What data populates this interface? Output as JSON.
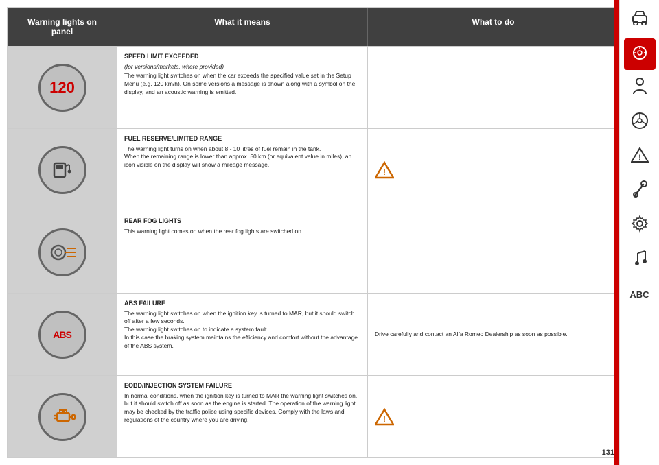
{
  "header": {
    "col1": "Warning lights on\npanel",
    "col2": "What it means",
    "col3": "What to do"
  },
  "rows": [
    {
      "icon_type": "speed",
      "icon_label": "120",
      "title": "SPEED LIMIT EXCEEDED",
      "subtitle": "(for versions/markets, where provided)",
      "meaning": "The warning light switches on when the car exceeds the specified value set in the Setup Menu (e.g. 120 km/h). On some versions a message is shown along with a symbol on the display, and an acoustic warning is emitted.",
      "action": ""
    },
    {
      "icon_type": "fuel",
      "icon_label": "⛽",
      "title": "FUEL RESERVE/LIMITED RANGE",
      "subtitle": "",
      "meaning": "The warning light turns on when about 8 - 10 litres of fuel remain in the tank.\nWhen the remaining range is lower than approx. 50 km (or equivalent value in miles), an icon visible on the display will show a mileage message.",
      "action": "warning_triangle"
    },
    {
      "icon_type": "fog",
      "icon_label": "fog",
      "title": "REAR FOG LIGHTS",
      "subtitle": "",
      "meaning": "This warning light comes on when the rear fog lights are switched on.",
      "action": ""
    },
    {
      "icon_type": "abs",
      "icon_label": "ABS",
      "title": "ABS FAILURE",
      "subtitle": "",
      "meaning": "The warning light switches on when the ignition key is turned to MAR, but it should switch off after a few seconds.\nThe warning light switches on to indicate a system fault.\nIn this case the braking system maintains the efficiency and comfort without the advantage of the ABS system.",
      "action": "Drive carefully and contact an Alfa Romeo Dealership as soon as possible."
    },
    {
      "icon_type": "engine",
      "icon_label": "🔧",
      "title": "EOBD/INJECTION SYSTEM FAILURE",
      "subtitle": "",
      "meaning": "In normal conditions, when the ignition key is turned to MAR the warning light switches on, but it should switch off as soon as the engine is started. The operation of the warning light may be checked by the traffic police using specific devices. Comply with the laws and regulations of the country where you are driving.",
      "action": "warning_triangle_amber"
    }
  ],
  "sidebar": {
    "items": [
      {
        "icon": "car",
        "label": "car-icon",
        "active": false
      },
      {
        "icon": "dashboard",
        "label": "dashboard-icon",
        "active": true
      },
      {
        "icon": "person",
        "label": "person-icon",
        "active": false
      },
      {
        "icon": "steering",
        "label": "steering-icon",
        "active": false
      },
      {
        "icon": "triangle",
        "label": "triangle-icon",
        "active": false
      },
      {
        "icon": "wrench",
        "label": "wrench-icon",
        "active": false
      },
      {
        "icon": "gear",
        "label": "gear-icon",
        "active": false
      },
      {
        "icon": "music",
        "label": "music-icon",
        "active": false
      },
      {
        "icon": "abc",
        "label": "abc-icon",
        "active": false
      }
    ]
  },
  "page_number": "131"
}
